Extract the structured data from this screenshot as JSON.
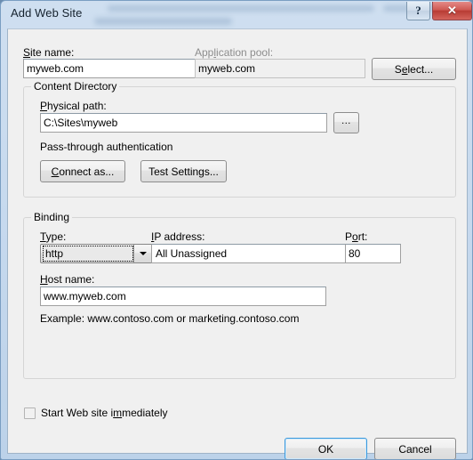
{
  "window": {
    "title": "Add Web Site",
    "help_button": "?",
    "close_button": "✕"
  },
  "fields": {
    "site_name_label": "Site name:",
    "site_name_value": "myweb.com",
    "app_pool_label": "Application pool:",
    "app_pool_value": "myweb.com",
    "select_button": "Select..."
  },
  "content_directory": {
    "group_title": "Content Directory",
    "physical_path_label": "Physical path:",
    "physical_path_value": "C:\\Sites\\myweb",
    "browse_button": "...",
    "auth_text": "Pass-through authentication",
    "connect_as_button": "Connect as...",
    "test_settings_button": "Test Settings..."
  },
  "binding": {
    "group_title": "Binding",
    "type_label": "Type:",
    "type_value": "http",
    "ip_label": "IP address:",
    "ip_value": "All Unassigned",
    "port_label": "Port:",
    "port_value": "80",
    "host_label": "Host name:",
    "host_value": "www.myweb.com",
    "example_text": "Example: www.contoso.com or marketing.contoso.com"
  },
  "footer": {
    "start_checkbox_label": "Start Web site immediately",
    "ok_button": "OK",
    "cancel_button": "Cancel"
  }
}
